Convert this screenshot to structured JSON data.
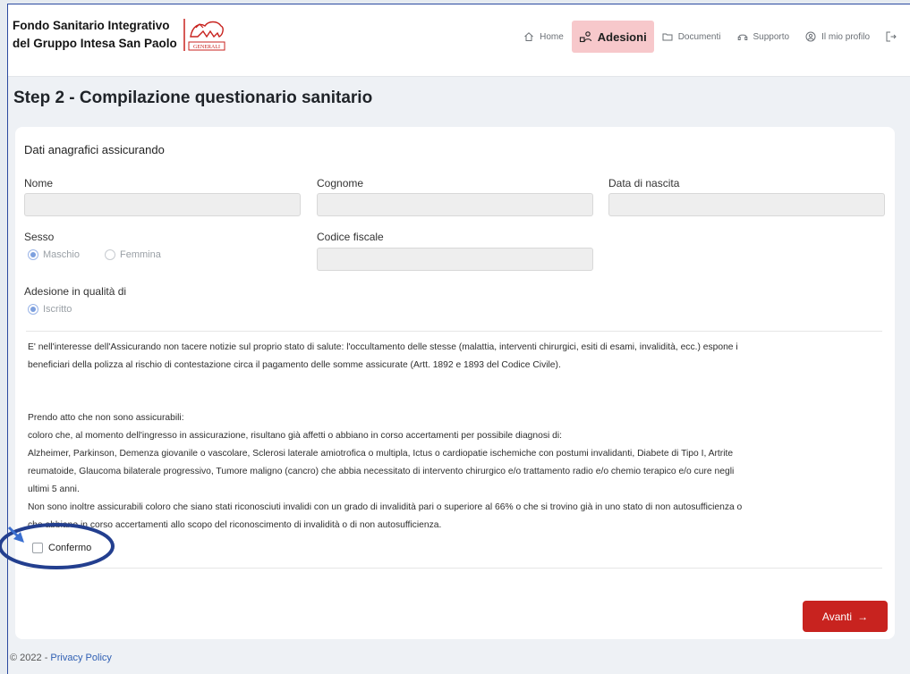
{
  "brand": {
    "line1": "Fondo Sanitario Integrativo",
    "line2": "del Gruppo Intesa San Paolo",
    "logo_text": "GENERALI"
  },
  "nav": {
    "home": "Home",
    "adesioni": "Adesioni",
    "documenti": "Documenti",
    "supporto": "Supporto",
    "profilo": "Il mio profilo"
  },
  "page_title": "Step 2 - Compilazione questionario sanitario",
  "form": {
    "section_title": "Dati anagrafici assicurando",
    "nome_label": "Nome",
    "cognome_label": "Cognome",
    "data_nascita_label": "Data di nascita",
    "sesso_label": "Sesso",
    "sesso_options": [
      "Maschio",
      "Femmina"
    ],
    "sesso_selected": "Maschio",
    "codice_fiscale_label": "Codice fiscale",
    "adesione_label": "Adesione in qualità di",
    "adesione_option": "Iscritto"
  },
  "disclaimer": {
    "line1": "E' nell'interesse dell'Assicurando non tacere notizie sul proprio stato di salute: l'occultamento delle stesse (malattia, interventi chirurgici, esiti di esami, invalidità, ecc.) espone i",
    "line2": "beneficiari della polizza al rischio di contestazione circa il pagamento delle somme assicurate (Artt. 1892 e 1893 del Codice Civile)."
  },
  "notice": {
    "line1": "Prendo atto che non sono assicurabili:",
    "line2": "coloro che, al momento dell'ingresso in assicurazione, risultano già affetti o abbiano in corso accertamenti per possibile diagnosi di:",
    "line3": "Alzheimer, Parkinson, Demenza giovanile o vascolare, Sclerosi laterale amiotrofica o multipla, Ictus o cardiopatie ischemiche con postumi invalidanti, Diabete di Tipo I, Artrite",
    "line4": "reumatoide, Glaucoma bilaterale progressivo, Tumore maligno (cancro) che abbia necessitato di intervento chirurgico e/o trattamento radio e/o chemio terapico e/o cure negli",
    "line5": "ultimi 5 anni.",
    "line6": "Non sono inoltre assicurabili coloro che siano stati riconosciuti invalidi con un grado di invalidità pari o superiore al 66% o che si trovino già in uno stato di non autosufficienza o",
    "line7": "che abbiano in corso accertamenti allo scopo del riconoscimento di invalidità o di non autosufficienza."
  },
  "confirm_label": "Confermo",
  "next_button": "Avanti",
  "footer": {
    "copyright": "© 2022 - ",
    "privacy": "Privacy Policy"
  },
  "colors": {
    "accent_red": "#c8231f",
    "nav_active_bg": "#f7c8cb",
    "annotation_blue": "#233f8f"
  },
  "icons": [
    "home-icon",
    "users-icon",
    "folder-icon",
    "headset-icon",
    "user-circle-icon",
    "logout-icon",
    "arrow-right-icon"
  ]
}
